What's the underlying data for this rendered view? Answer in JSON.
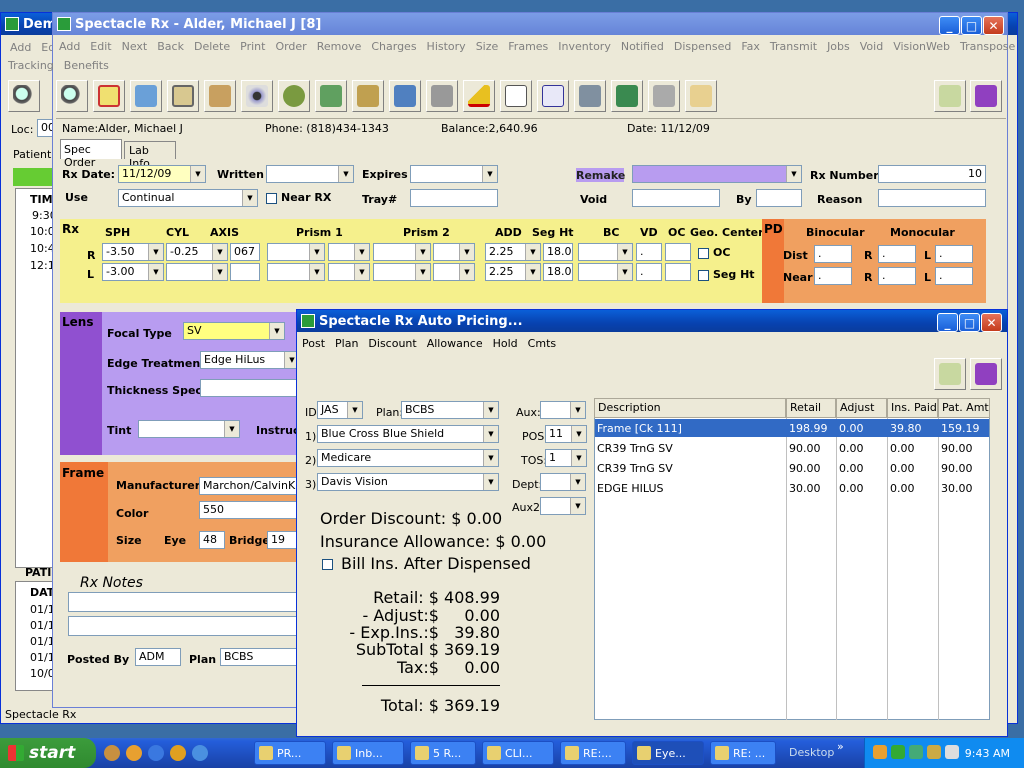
{
  "back_window": {
    "title": "Dem",
    "menu": [
      "Add",
      "Ed"
    ],
    "loc_label": "Loc:",
    "loc_value": "00",
    "patient_tab": "Patient",
    "time_header": "TIM",
    "times": [
      "9:30",
      "10:0",
      "10:4",
      "12:1"
    ],
    "pat_header": "PATI",
    "dat_header": "DAT",
    "dates": [
      "01/1",
      "01/1",
      "01/1",
      "01/1",
      "10/0"
    ]
  },
  "main_window": {
    "title": "Spectacle Rx - Alder, Michael J [8]",
    "menu": [
      "Add",
      "Edit",
      "Next",
      "Back",
      "Delete",
      "Print",
      "Order",
      "Remove",
      "Charges",
      "History",
      "Size",
      "Frames",
      "Inventory",
      "Notified",
      "Dispensed",
      "Fax",
      "Transmit",
      "Jobs",
      "Void",
      "VisionWeb",
      "Transpose"
    ],
    "menu2": [
      "Tracking",
      "Benefits"
    ],
    "toolbar_icons": [
      "search-icon",
      "calendar-icon",
      "people-icon",
      "clipboard-icon",
      "medical-kit-icon",
      "eye-icon",
      "money-bag-icon",
      "family-icon",
      "stamp-icon",
      "ruler-icon",
      "tools-icon",
      "warning-icon",
      "note-icon",
      "document-icon",
      "computer-icon",
      "cash-drawer-icon",
      "chain-icon",
      "folders-icon"
    ],
    "right_icons": [
      "folders-icon",
      "help-book-icon"
    ],
    "name": "Name:Alder, Michael J",
    "phone": "Phone: (818)434-1343",
    "balance": "Balance:2,640.96",
    "date": "Date: 11/12/09",
    "tabs": [
      "Spec Order",
      "Lab Info"
    ],
    "rx_date_label": "Rx Date:",
    "rx_date": "11/12/09",
    "written_label": "Written",
    "expires_label": "Expires",
    "remake_label": "Remake",
    "rx_number_label": "Rx Number",
    "rx_number": "10",
    "use_label": "Use",
    "use_value": "Continual",
    "near_rx_label": "Near RX",
    "tray_label": "Tray#",
    "void_label": "Void",
    "by_label": "By",
    "reason_label": "Reason",
    "rx_section": "Rx",
    "rx_cols": [
      "SPH",
      "CYL",
      "AXIS",
      "Prism 1",
      "Prism 2",
      "ADD",
      "Seg Ht",
      "BC",
      "VD",
      "OC",
      "Geo. Center"
    ],
    "rows": [
      {
        "eye": "R",
        "sph": "-3.50",
        "cyl": "-0.25",
        "axis": "067",
        "add": "2.25",
        "seg": "18.0",
        "vd": "."
      },
      {
        "eye": "L",
        "sph": "-3.00",
        "cyl": "",
        "axis": "",
        "add": "2.25",
        "seg": "18.0",
        "vd": "."
      }
    ],
    "oc_label": "OC",
    "segh_label": "Seg Ht",
    "pd_label": "PD",
    "binocular": "Binocular",
    "monocular": "Monocular",
    "dist": "Dist",
    "near": "Near",
    "r": "R",
    "l": "L",
    "dot": ".",
    "lens_label": "Lens",
    "focal_type_label": "Focal Type",
    "focal_type": "SV",
    "edge_label": "Edge Treatment",
    "edge_value": "Edge HiLus",
    "thickness_label": "Thickness Spec.",
    "tint_label": "Tint",
    "instr_label": "Instruc",
    "frame_label": "Frame",
    "manufacturer_label": "Manufacturer",
    "manufacturer": "Marchon/CalvinK",
    "color_label": "Color",
    "color": "550",
    "size_label": "Size",
    "eye_label": "Eye",
    "eye_value": "48",
    "bridge_label": "Bridge",
    "bridge_value": "19",
    "notes_label": "Rx Notes",
    "posted_by_label": "Posted By",
    "posted_by": "ADM",
    "plan_label": "Plan",
    "plan": "BCBS",
    "status": "Spectacle Rx"
  },
  "pricing": {
    "title": "Spectacle Rx Auto Pricing...",
    "menu": [
      "Post",
      "Plan",
      "Discount",
      "Allowance",
      "Hold",
      "Cmts"
    ],
    "id_label": "ID",
    "id_value": "JAS",
    "plan_label": "Plan:",
    "plan_value": "BCBS",
    "aux_label": "Aux:",
    "pos_label": "POS:",
    "pos_value": "11",
    "tos_label": "TOS:",
    "tos_value": "1",
    "dept_label": "Dept:",
    "aux2_label": "Aux2:",
    "ins": [
      {
        "n": "1)",
        "v": "Blue Cross Blue Shield"
      },
      {
        "n": "2)",
        "v": "Medicare"
      },
      {
        "n": "3)",
        "v": "Davis Vision"
      }
    ],
    "order_discount": "Order Discount: $  0.00",
    "ins_allowance": "Insurance Allowance: $  0.00",
    "bill_ins": "Bill Ins. After Dispensed",
    "retail": "Retail: $ 408.99",
    "adjust": "- Adjust:$     0.00",
    "exp_ins": "- Exp.Ins.:$   39.80",
    "subtotal": "SubTotal $ 369.19",
    "tax": "Tax:$     0.00",
    "total": "Total: $ 369.19",
    "columns": [
      "Description",
      "Retail",
      "Adjust",
      "Ins. Paid",
      "Pat. Amt"
    ],
    "rows": [
      [
        "Frame [Ck  111]",
        "198.99",
        "0.00",
        "39.80",
        "159.19"
      ],
      [
        "CR39 TrnG SV",
        "90.00",
        "0.00",
        "0.00",
        "90.00"
      ],
      [
        "CR39 TrnG SV",
        "90.00",
        "0.00",
        "0.00",
        "90.00"
      ],
      [
        "EDGE HILUS",
        "30.00",
        "0.00",
        "0.00",
        "30.00"
      ]
    ]
  },
  "taskbar": {
    "start": "start",
    "buttons": [
      "PR...",
      "Inb...",
      "5 R...",
      "CLI...",
      "RE:...",
      "Eye...",
      "RE: ...",
      "Desktop"
    ],
    "clock": "9:43 AM"
  },
  "colors": {
    "yellow": "#f5f08c",
    "orange": "#f0a060",
    "purple": "#9050d0",
    "lilac": "#b89cf0",
    "selected": "#316ac5"
  }
}
